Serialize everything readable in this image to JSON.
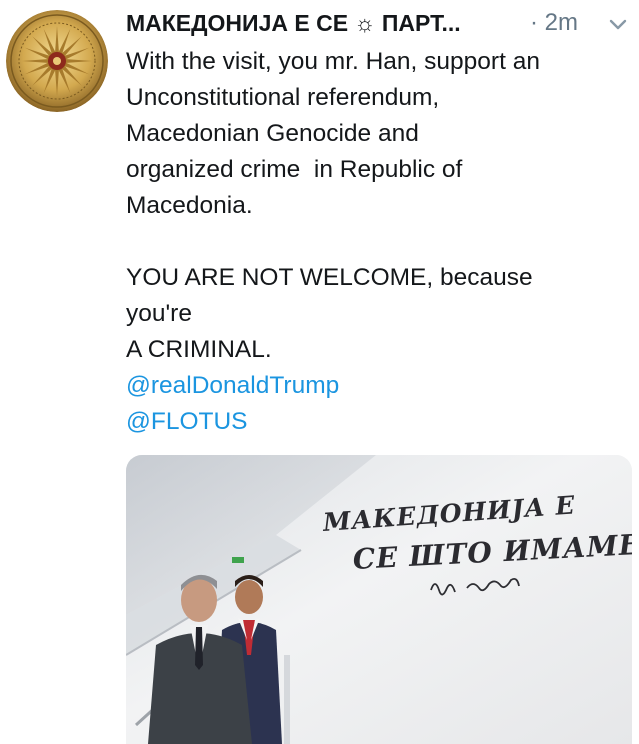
{
  "tweet": {
    "author_name": "МАКЕДОНИЈА Е СЕ ☼ ПАРТ...",
    "timestamp": "· 2m",
    "body_lines": [
      "With the visit, you mr. Han, support an",
      "Unconstitutional referendum,",
      "Macedonian Genocide and",
      "organized crime  in Republic of",
      "Macedonia."
    ],
    "body_lines_2": [
      "YOU ARE NOT WELCOME, because",
      "you're",
      "A CRIMINAL."
    ],
    "mentions": [
      "@realDonaldTrump",
      "@FLOTUS"
    ],
    "media": {
      "wall_text_line1": "МАКЕДОНИЈА Е",
      "wall_text_line2": "СЕ ШТО ИМАМЕ"
    }
  },
  "icons": {
    "avatar": "vergina-sun-emblem",
    "caret": "chevron-down-icon"
  },
  "colors": {
    "text": "#14171a",
    "muted": "#657786",
    "link": "#1b95e0",
    "avatar_gold": "#c9a24a"
  }
}
